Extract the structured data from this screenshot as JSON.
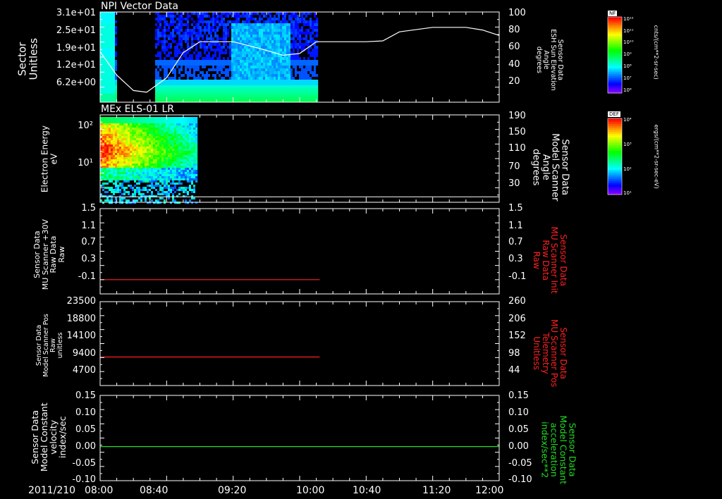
{
  "date_label": "2011/210",
  "time_ticks": [
    "08:00",
    "08:40",
    "09:20",
    "10:00",
    "10:40",
    "11:20",
    "12:00"
  ],
  "panels": [
    {
      "title": "NPI Vector Data",
      "left_label": "Sector\nUnitless",
      "left_ticks": [
        "3.1e+01",
        "2.5e+01",
        "1.9e+01",
        "1.2e+01",
        "6.2e+00"
      ],
      "right_label": "Sensor Data\nESH Sun Elevation\nAngle\ndegrees",
      "right_ticks": [
        "100",
        "80",
        "60",
        "40",
        "20"
      ],
      "colorbar": {
        "title": "NF",
        "unit": "cnts/(cm**2-sr-sec)",
        "ticks": [
          "10¹²",
          "10¹¹",
          "10¹⁰",
          "10⁹",
          "10⁸",
          "10⁷",
          "10⁶"
        ]
      }
    },
    {
      "title": "MEx ELS-01 LR",
      "left_label": "Electron Energy\neV",
      "left_ticks": [
        "10²",
        "10¹"
      ],
      "right_label": "Sensor Data\nModel Scanner\nAngle\ndegrees",
      "right_ticks": [
        "190",
        "150",
        "110",
        "70",
        "30"
      ],
      "colorbar": {
        "title": "DEF",
        "unit": "ergs/(cm**2-sr-sec-eV)",
        "ticks": [
          "10⁴",
          "10³",
          "10²",
          "10¹"
        ]
      }
    },
    {
      "title": "",
      "left_label": "Sensor Data\nMU Scanner +30V\nRaw Data\nRaw",
      "left_ticks": [
        "1.5",
        "1.1",
        "0.7",
        "0.3",
        "-0.1"
      ],
      "right_label": "Sensor Data\nMU Scanner Init\nRaw Data\nRaw",
      "right_ticks": [
        "1.5",
        "1.1",
        "0.7",
        "0.3",
        "-0.1"
      ]
    },
    {
      "title": "",
      "left_label": "Sensor Data\nModel Scanner Pos\nRaw\nunitless",
      "left_ticks": [
        "23500",
        "18800",
        "14100",
        "9400",
        "4700"
      ],
      "right_label": "Sensor Data\nMU Scanner Pos\nTelemetry\nUnitless",
      "right_ticks": [
        "260",
        "206",
        "152",
        "98",
        "44"
      ]
    },
    {
      "title": "",
      "left_label": "Sensor Data\nModel Constant\nvelocity\nindex/sec",
      "left_ticks": [
        "0.15",
        "0.10",
        "0.05",
        "0.00",
        "-0.05",
        "-0.10"
      ],
      "right_label": "Sensor Data\nModel Constant\nacceleration\nindex/sec**2",
      "right_ticks": [
        "0.15",
        "0.10",
        "0.05",
        "0.00",
        "-0.05",
        "-0.10"
      ]
    }
  ],
  "chart_data": [
    {
      "type": "heatmap",
      "title": "NPI Vector Data",
      "x_range": [
        "08:00",
        "12:00"
      ],
      "ylabel": "Sector Unitless",
      "y_ticks": [
        "3.1e+01",
        "2.5e+01",
        "1.9e+01",
        "1.2e+01",
        "6.2e+00"
      ],
      "data_extent": [
        "08:00",
        "10:10"
      ],
      "overlay_series": {
        "name": "ESH Sun Elevation Angle",
        "ylim": [
          0,
          100
        ],
        "x": [
          "08:00",
          "08:10",
          "08:20",
          "08:28",
          "08:40",
          "08:50",
          "09:00",
          "09:20",
          "09:35",
          "09:50",
          "10:00",
          "10:10",
          "10:40",
          "10:50",
          "11:00",
          "11:20",
          "11:40",
          "11:50",
          "12:00"
        ],
        "y": [
          56,
          30,
          13,
          11,
          27,
          55,
          67,
          67,
          60,
          52,
          54,
          67,
          67,
          68,
          78,
          83,
          83,
          80,
          74
        ]
      },
      "colorbar": {
        "label": "NF",
        "unit": "cnts/(cm**2-sr-sec)",
        "range_log10": [
          6,
          12
        ]
      }
    },
    {
      "type": "heatmap",
      "title": "MEx ELS-01 LR",
      "x_range": [
        "08:00",
        "12:00"
      ],
      "ylabel": "Electron Energy eV",
      "y_log": true,
      "y_ticks": [
        "10²",
        "10¹"
      ],
      "data_extent": [
        "08:00",
        "08:58"
      ],
      "overlay_series": {
        "name": "Model Scanner Angle",
        "ylim": [
          0,
          190
        ],
        "x": [
          "08:00",
          "12:00"
        ],
        "y": [
          12,
          12
        ]
      },
      "colorbar": {
        "label": "DEF",
        "unit": "ergs/(cm**2-sr-sec-eV)",
        "range_log10": [
          1,
          4
        ]
      }
    },
    {
      "type": "line",
      "ylim": [
        -0.3,
        1.5
      ],
      "series": [
        {
          "name": "MU Scanner Init Raw Data",
          "color": "#ff2020",
          "x": [
            "08:00",
            "10:12"
          ],
          "y": [
            0.0,
            0.0
          ]
        }
      ]
    },
    {
      "type": "line",
      "ylim": [
        0,
        23500
      ],
      "series": [
        {
          "name": "MU Scanner Pos Telemetry",
          "color": "#ff2020",
          "x": [
            "08:00",
            "10:12"
          ],
          "y": [
            8000,
            8000
          ]
        }
      ]
    },
    {
      "type": "line",
      "ylim": [
        -0.1,
        0.15
      ],
      "series": [
        {
          "name": "Model Constant acceleration",
          "color": "#22dd22",
          "x": [
            "08:00",
            "12:00"
          ],
          "y": [
            0.0,
            0.0
          ]
        }
      ]
    }
  ]
}
